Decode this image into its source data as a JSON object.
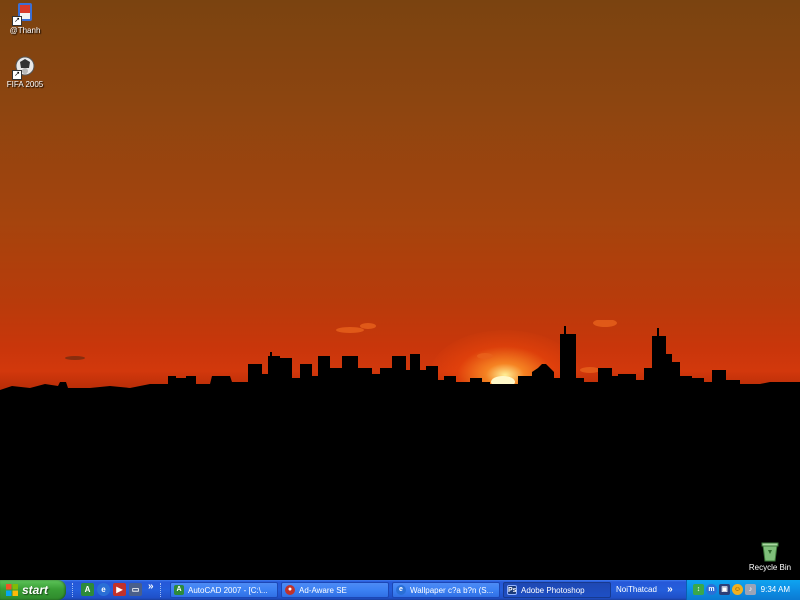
{
  "desktop": {
    "icons": [
      {
        "label": "@Thanh",
        "icon": "thanh-shortcut-icon"
      },
      {
        "label": "FIFA 2005",
        "icon": "fifa-shortcut-icon"
      }
    ],
    "recycle_bin": {
      "label": "Recycle Bin",
      "icon": "recycle-bin-icon"
    }
  },
  "taskbar": {
    "start_label": "start",
    "quick_launch_chevron": "»",
    "tasks": [
      {
        "label": "AutoCAD 2007 - [C:\\...",
        "icon": "autocad-icon",
        "color": "#2d8a3a"
      },
      {
        "label": "Ad-Aware SE",
        "icon": "ad-aware-icon",
        "color": "#c0322b"
      },
      {
        "label": "Wallpaper c?a b?n (S...",
        "icon": "ie-icon",
        "color": "#2a6fd6"
      },
      {
        "label": "Adobe Photoshop",
        "icon": "photoshop-icon",
        "color": "#1b3a78"
      }
    ],
    "toolbar_label": "NoiThatcad",
    "toolbar_chevron": "»",
    "clock": "9:34 AM"
  },
  "colors": {
    "taskbar_blue": "#245edb",
    "start_green": "#3a9f36",
    "tray_blue": "#0d8ee4"
  }
}
